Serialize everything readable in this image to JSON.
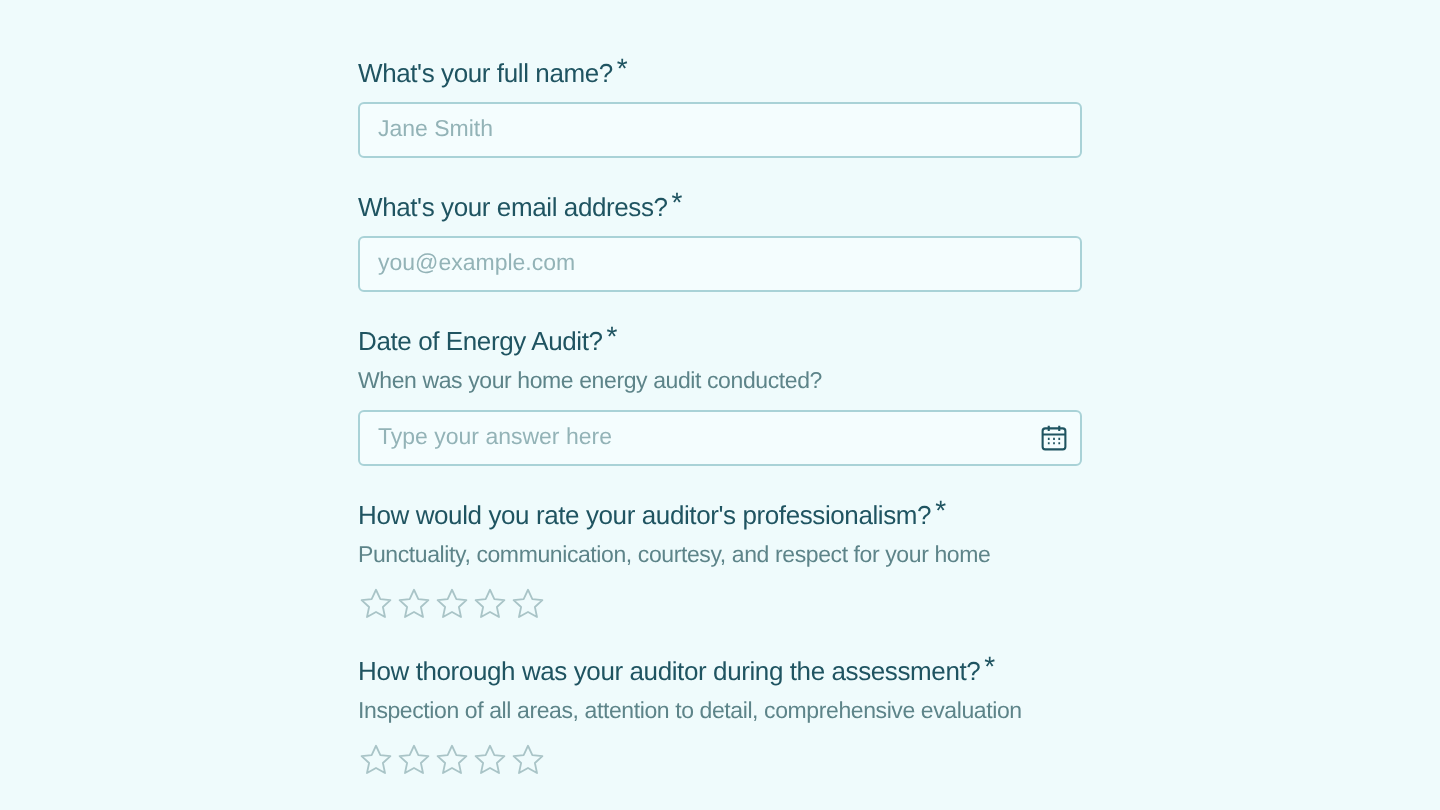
{
  "questions": [
    {
      "kind": "text",
      "label": "What's your full name?",
      "required_mark": "*",
      "placeholder": "Jane Smith"
    },
    {
      "kind": "text",
      "label": "What's your email address?",
      "required_mark": "*",
      "placeholder": "you@example.com"
    },
    {
      "kind": "date",
      "label": "Date of Energy Audit?",
      "required_mark": "*",
      "hint": "When was your home energy audit conducted?",
      "placeholder": "Type your answer here"
    },
    {
      "kind": "rating",
      "label": "How would you rate your auditor's professionalism?",
      "required_mark": "*",
      "hint": "Punctuality, communication, courtesy, and respect for your home",
      "stars": 0
    },
    {
      "kind": "rating",
      "label": "How thorough was your auditor during the assessment?",
      "required_mark": "*",
      "hint": "Inspection of all areas, attention to detail, comprehensive evaluation",
      "stars": 0
    }
  ]
}
